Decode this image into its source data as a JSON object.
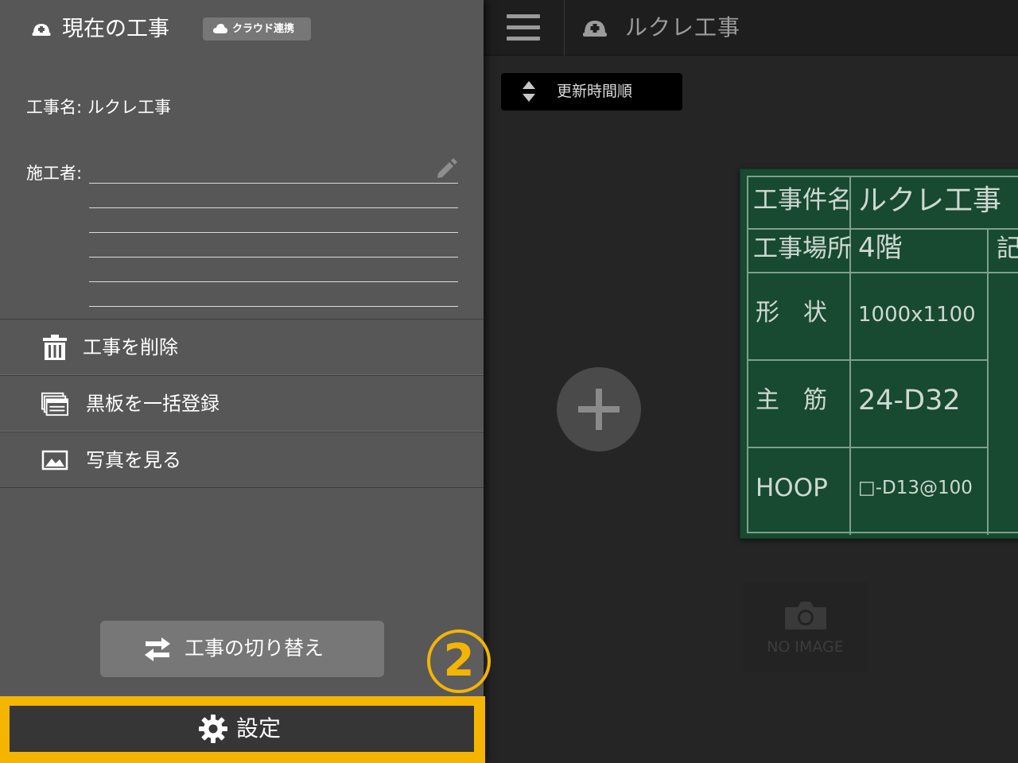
{
  "app": {
    "title": "ルクレ工事",
    "sort_label": "更新時間順"
  },
  "drawer": {
    "title": "現在の工事",
    "cloud_badge": "クラウド連携",
    "project_name_label": "工事名:",
    "project_name_value": "ルクレ工事",
    "builder_label": "施工者:",
    "menu": [
      {
        "label": "工事を削除",
        "icon": "trash-icon"
      },
      {
        "label": "黒板を一括登録",
        "icon": "blackboard-stack-icon"
      },
      {
        "label": "写真を見る",
        "icon": "image-icon"
      }
    ],
    "switch_label": "工事の切り替え",
    "settings_label": "設定"
  },
  "blackboard": {
    "rows": [
      {
        "label": "工事件名",
        "value": "ルクレ工事"
      },
      {
        "label": "工事場所",
        "value": "4階",
        "extra": "記"
      },
      {
        "label": "形　状",
        "value": "1000x1100"
      },
      {
        "label": "主　筋",
        "value": "24-D32"
      },
      {
        "label": "HOOP",
        "value": "□-D13@100"
      }
    ]
  },
  "no_image": {
    "label": "NO IMAGE"
  },
  "annotation": {
    "step": "2"
  },
  "colors": {
    "highlight": "#f5b400",
    "drawer_bg": "#575757",
    "blackboard_bg": "#174a30"
  }
}
